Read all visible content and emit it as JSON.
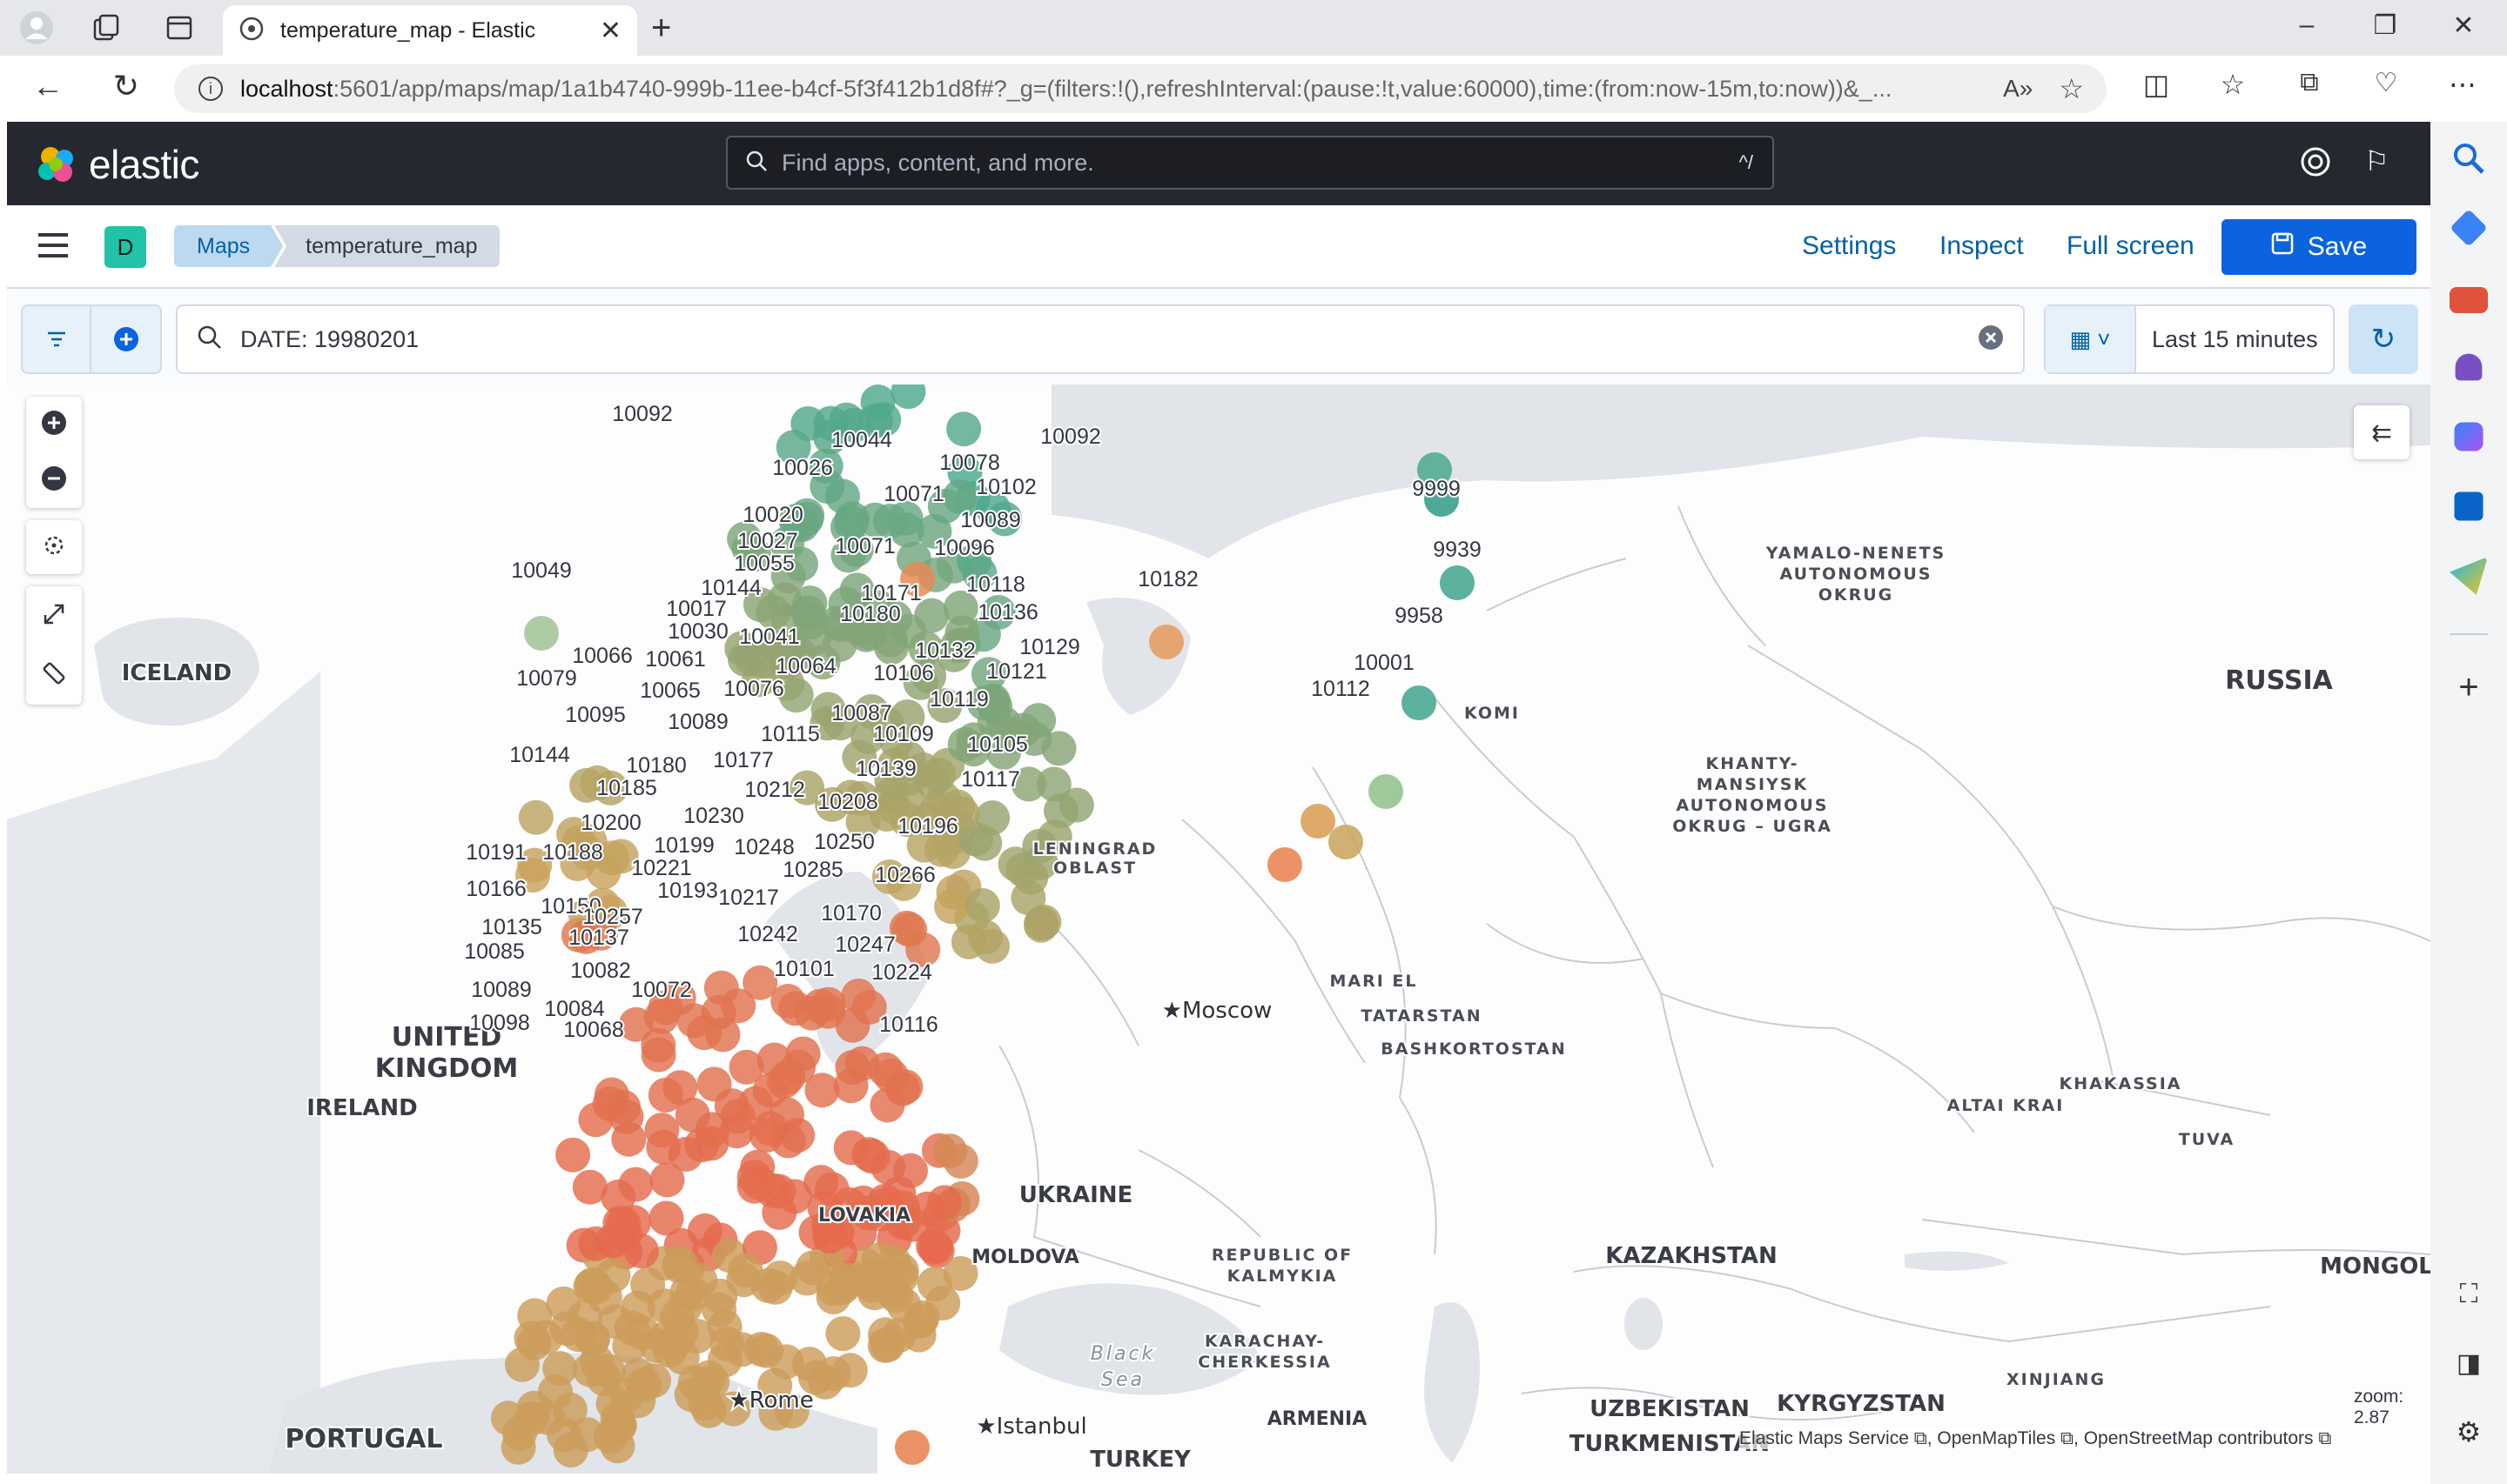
{
  "browser": {
    "tab_title": "temperature_map - Elastic",
    "url_host": "localhost",
    "url_rest": ":5601/app/maps/map/1a1b4740-999b-11ee-b4cf-5f3f412b1d8f#?_g=(filters:!(),refreshInterval:(pause:!t,value:60000),time:(from:now-15m,to:now))&_..."
  },
  "kibana": {
    "brand": "elastic",
    "search_placeholder": "Find apps, content, and more.",
    "search_shortcut": "^/",
    "space_badge": "D",
    "breadcrumbs": [
      "Maps",
      "temperature_map"
    ],
    "links": {
      "settings": "Settings",
      "inspect": "Inspect",
      "fullscreen": "Full screen",
      "save": "Save"
    },
    "query": "DATE: 19980201",
    "time_range": "Last 15 minutes"
  },
  "map": {
    "zoom_text": "zoom: 2.87",
    "attribution": [
      "Elastic Maps Service",
      "OpenMapTiles",
      "OpenStreetMap contributors"
    ],
    "place_labels": [
      {
        "t": "ICELAND",
        "cls": "region"
      },
      {
        "t": "RUSSIA",
        "cls": "country"
      },
      {
        "t": "UNITED",
        "cls": "country"
      },
      {
        "t": "KINGDOM",
        "cls": "country"
      },
      {
        "t": "IRELAND",
        "cls": "region"
      },
      {
        "t": "PORTUGAL",
        "cls": "country"
      },
      {
        "t": "UKRAINE",
        "cls": "region"
      },
      {
        "t": "MOLDOVA",
        "cls": "small"
      },
      {
        "t": "KAZAKHSTAN",
        "cls": "region"
      },
      {
        "t": "UZBEKISTAN",
        "cls": "region"
      },
      {
        "t": "KYRGYZSTAN",
        "cls": "region"
      },
      {
        "t": "TURKMENISTAN",
        "cls": "region"
      },
      {
        "t": "TURKEY",
        "cls": "region"
      },
      {
        "t": "ARMENIA",
        "cls": "small"
      },
      {
        "t": "MONGOL",
        "cls": "region"
      },
      {
        "t": "LOVAKIA",
        "cls": "small"
      },
      {
        "t": "YAMALO-NENETS",
        "cls": "tiny"
      },
      {
        "t": "AUTONOMOUS",
        "cls": "tiny"
      },
      {
        "t": "OKRUG",
        "cls": "tiny"
      },
      {
        "t": "KHANTY-",
        "cls": "tiny"
      },
      {
        "t": "MANSIYSK",
        "cls": "tiny"
      },
      {
        "t": "AUTONOMOUS",
        "cls": "tiny"
      },
      {
        "t": "OKRUG – UGRA",
        "cls": "tiny"
      },
      {
        "t": "KOMI",
        "cls": "tiny"
      },
      {
        "t": "LENINGRAD",
        "cls": "tiny"
      },
      {
        "t": "OBLAST",
        "cls": "tiny"
      },
      {
        "t": "MARI EL",
        "cls": "tiny"
      },
      {
        "t": "TATARSTAN",
        "cls": "tiny"
      },
      {
        "t": "BASHKORTOSTAN",
        "cls": "tiny"
      },
      {
        "t": "ALTAI KRAI",
        "cls": "tiny"
      },
      {
        "t": "KHAKASSIA",
        "cls": "tiny"
      },
      {
        "t": "TUVA",
        "cls": "tiny"
      },
      {
        "t": "REPUBLIC OF",
        "cls": "tiny"
      },
      {
        "t": "KALMYKIA",
        "cls": "tiny"
      },
      {
        "t": "KARACHAY-",
        "cls": "tiny"
      },
      {
        "t": "CHERKESSIA",
        "cls": "tiny"
      },
      {
        "t": "XINJIANG",
        "cls": "tiny"
      },
      {
        "t": "Black",
        "cls": "sea"
      },
      {
        "t": "Sea",
        "cls": "sea"
      },
      {
        "t": "Moscow",
        "cls": "city"
      },
      {
        "t": "Rome",
        "cls": "city"
      },
      {
        "t": "Istanbul",
        "cls": "city"
      }
    ],
    "station_labels": [
      "10092",
      "10044",
      "10092",
      "10078",
      "10026",
      "10102",
      "10071",
      "10020",
      "10089",
      "10027",
      "10096",
      "10071",
      "10055",
      "10049",
      "10182",
      "10118",
      "10144",
      "10171",
      "10136",
      "10017",
      "10180",
      "10030",
      "10041",
      "10129",
      "10132",
      "10066",
      "10061",
      "10064",
      "10121",
      "10106",
      "10079",
      "10065",
      "10076",
      "10119",
      "10087",
      "10095",
      "10089",
      "10115",
      "10109",
      "10105",
      "10144",
      "10180",
      "10177",
      "10139",
      "10117",
      "10185",
      "10212",
      "10208",
      "10230",
      "10200",
      "10196",
      "10199",
      "10248",
      "10250",
      "10191",
      "10188",
      "10221",
      "10285",
      "10266",
      "10166",
      "10193",
      "10217",
      "10150",
      "10170",
      "10257",
      "10135",
      "10137",
      "10242",
      "10247",
      "10085",
      "10082",
      "10101",
      "10224",
      "10089",
      "10072",
      "10084",
      "10098",
      "10068",
      "10116",
      "9999",
      "9939",
      "9958",
      "10001",
      "10112"
    ],
    "legend_scale": {
      "low_color": "#4aa88e",
      "mid_color": "#c9a25c",
      "high_color": "#e7664c"
    }
  }
}
